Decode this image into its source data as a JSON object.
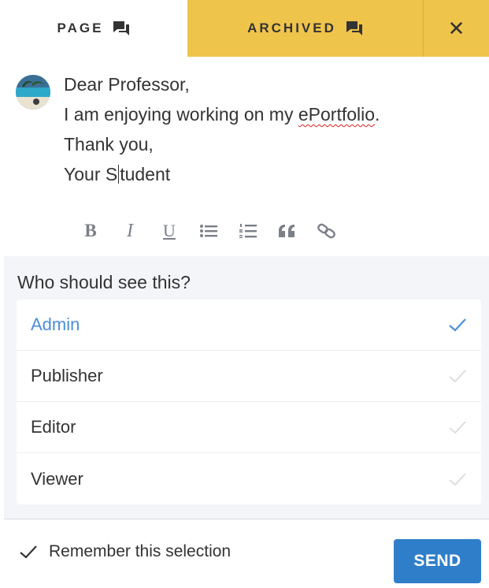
{
  "tabs": {
    "page_label": "PAGE",
    "archived_label": "ARCHIVED",
    "close_glyph": "✕",
    "accent_color": "#efc44b"
  },
  "message": {
    "greeting": "Dear Professor,",
    "body_prefix": "I am enjoying working on my ",
    "body_misspelled_word": "ePortfolio",
    "body_suffix": ".",
    "thanks": "Thank you,",
    "signoff_before_caret": "Your S",
    "signoff_after_caret": "tudent"
  },
  "toolbar": {
    "bold": "B",
    "italic": "I",
    "underline": "U",
    "icons": [
      "bulleted-list-icon",
      "numbered-list-icon",
      "quote-icon",
      "link-icon"
    ]
  },
  "visibility": {
    "question": "Who should see this?",
    "roles": [
      {
        "label": "Admin",
        "selected": true
      },
      {
        "label": "Publisher",
        "selected": false
      },
      {
        "label": "Editor",
        "selected": false
      },
      {
        "label": "Viewer",
        "selected": false
      }
    ],
    "selected_color": "#4a8fdc",
    "unselected_check_color": "#dcdde0"
  },
  "footer": {
    "remember_label": "Remember this selection",
    "remember_checked": true,
    "send_label": "SEND",
    "send_color": "#2f7ec9"
  }
}
